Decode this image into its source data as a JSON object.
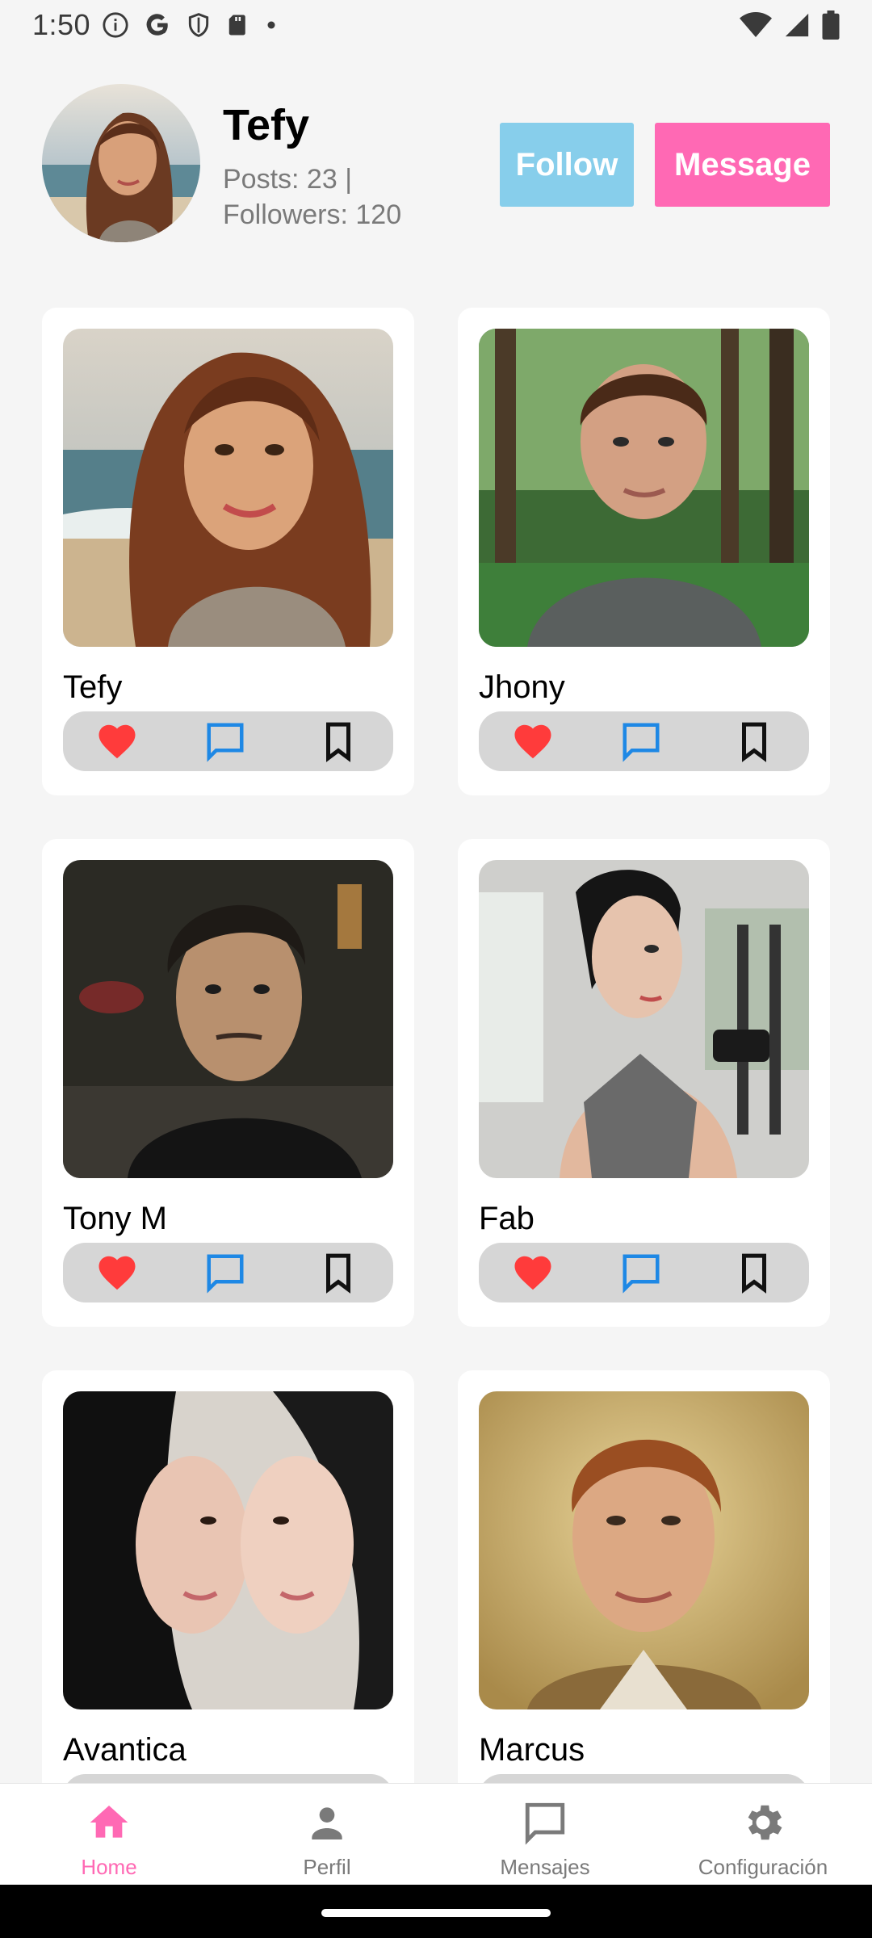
{
  "status_bar": {
    "time": "1:50",
    "icons_left": [
      "info-icon",
      "google-icon",
      "shield-icon",
      "sd-card-icon",
      "dot-icon"
    ],
    "icons_right": [
      "wifi-icon",
      "signal-icon",
      "battery-icon"
    ]
  },
  "profile": {
    "name": "Tefy",
    "stats": "Posts: 23 | Followers: 120",
    "follow_label": "Follow",
    "message_label": "Message",
    "colors": {
      "follow": "#87ceeb",
      "message": "#ff69b4"
    }
  },
  "cards": [
    {
      "name": "Tefy"
    },
    {
      "name": "Jhony"
    },
    {
      "name": "Tony M"
    },
    {
      "name": "Fab"
    },
    {
      "name": "Avantica"
    },
    {
      "name": "Marcus"
    }
  ],
  "card_actions": {
    "like_icon": "heart-icon",
    "comment_icon": "comment-icon",
    "save_icon": "bookmark-icon",
    "like_color": "#ff3b3b",
    "comment_color": "#1e88e5"
  },
  "bottom_nav": {
    "items": [
      {
        "label": "Home",
        "icon": "home-icon",
        "active": true
      },
      {
        "label": "Perfil",
        "icon": "person-icon",
        "active": false
      },
      {
        "label": "Mensajes",
        "icon": "chat-icon",
        "active": false
      },
      {
        "label": "Configuración",
        "icon": "gear-icon",
        "active": false
      }
    ],
    "active_color": "#ff69b4"
  }
}
